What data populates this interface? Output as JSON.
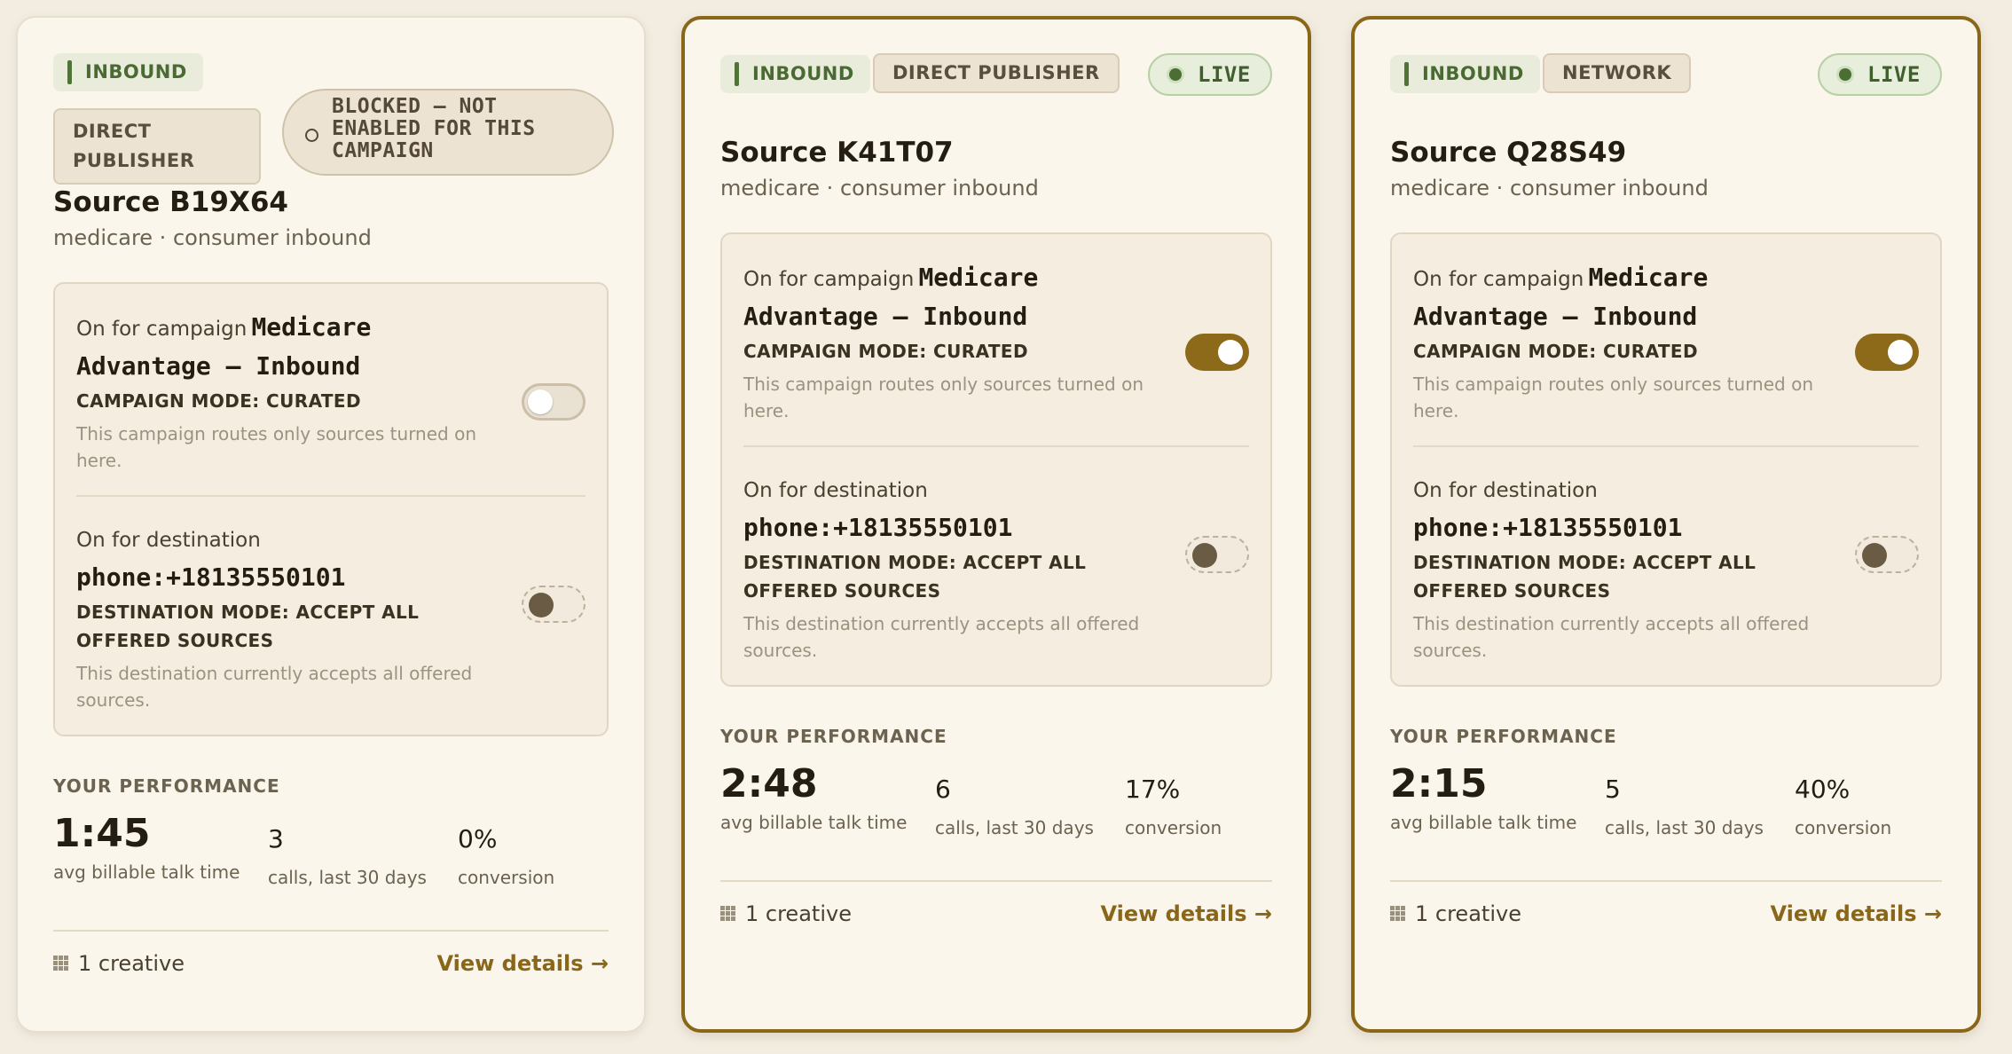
{
  "accent_color": "#8a6618",
  "performance_heading": "YOUR PERFORMANCE",
  "cards": [
    {
      "tags": [
        "INBOUND",
        "DIRECT PUBLISHER"
      ],
      "status": "BLOCKED — NOT ENABLED FOR THIS CAMPAIGN",
      "title": "Source B19X64",
      "subtitle": "medicare · consumer inbound",
      "campaign_label": "On for campaign",
      "campaign_name": "Medicare Advantage — Inbound",
      "campaign_mode": "CAMPAIGN MODE: CURATED",
      "campaign_note": "This campaign routes only sources turned on here.",
      "campaign_toggle": "off",
      "dest_label": "On for destination",
      "dest_value": "phone:+18135550101",
      "dest_mode": "DESTINATION MODE: ACCEPT ALL OFFERED SOURCES",
      "dest_note": "This destination currently accepts all offered sources.",
      "talk_time": "1:45",
      "talk_time_caption": "avg billable talk time",
      "calls": "3",
      "calls_caption": "calls, last 30 days",
      "conversion": "0%",
      "conversion_caption": "conversion",
      "creatives": "1 creative",
      "view_details": "View details →"
    },
    {
      "tags": [
        "INBOUND",
        "DIRECT PUBLISHER"
      ],
      "status": "LIVE",
      "title": "Source K41T07",
      "subtitle": "medicare · consumer inbound",
      "campaign_label": "On for campaign",
      "campaign_name": "Medicare Advantage — Inbound",
      "campaign_mode": "CAMPAIGN MODE: CURATED",
      "campaign_note": "This campaign routes only sources turned on here.",
      "campaign_toggle": "on",
      "dest_label": "On for destination",
      "dest_value": "phone:+18135550101",
      "dest_mode": "DESTINATION MODE: ACCEPT ALL OFFERED SOURCES",
      "dest_note": "This destination currently accepts all offered sources.",
      "talk_time": "2:48",
      "talk_time_caption": "avg billable talk time",
      "calls": "6",
      "calls_caption": "calls, last 30 days",
      "conversion": "17%",
      "conversion_caption": "conversion",
      "creatives": "1 creative",
      "view_details": "View details →"
    },
    {
      "tags": [
        "INBOUND",
        "NETWORK"
      ],
      "status": "LIVE",
      "title": "Source Q28S49",
      "subtitle": "medicare · consumer inbound",
      "campaign_label": "On for campaign",
      "campaign_name": "Medicare Advantage — Inbound",
      "campaign_mode": "CAMPAIGN MODE: CURATED",
      "campaign_note": "This campaign routes only sources turned on here.",
      "campaign_toggle": "on",
      "dest_label": "On for destination",
      "dest_value": "phone:+18135550101",
      "dest_mode": "DESTINATION MODE: ACCEPT ALL OFFERED SOURCES",
      "dest_note": "This destination currently accepts all offered sources.",
      "talk_time": "2:15",
      "talk_time_caption": "avg billable talk time",
      "calls": "5",
      "calls_caption": "calls, last 30 days",
      "conversion": "40%",
      "conversion_caption": "conversion",
      "creatives": "1 creative",
      "view_details": "View details →"
    }
  ]
}
